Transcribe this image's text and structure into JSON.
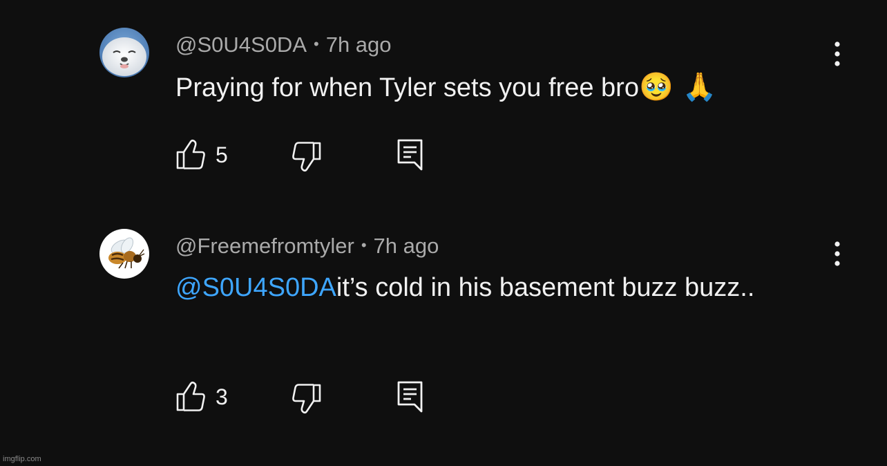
{
  "comments": [
    {
      "handle": "@S0U4S0DA",
      "separator": "•",
      "time": "7h ago",
      "mention": "",
      "text": "Praying for when Tyler sets you free bro",
      "emojis": "🥹 🙏",
      "likes": "5",
      "avatar_icon": "seal-avatar"
    },
    {
      "handle": "@Freemefromtyler",
      "separator": "•",
      "time": "7h ago",
      "mention": "@S0U4S0DA",
      "text": "it’s cold in his basement buzz buzz..",
      "emojis": "",
      "likes": "3",
      "avatar_icon": "bee-avatar"
    }
  ],
  "icons": {
    "more": "more-vertical-icon",
    "like": "thumbs-up-icon",
    "dislike": "thumbs-down-icon",
    "reply": "reply-comment-icon"
  },
  "colors": {
    "background": "#0f0f0f",
    "mention": "#3ea6ff",
    "meta": "#aaaaaa",
    "text": "#f1f1f1"
  },
  "watermark": "imgflip.com"
}
